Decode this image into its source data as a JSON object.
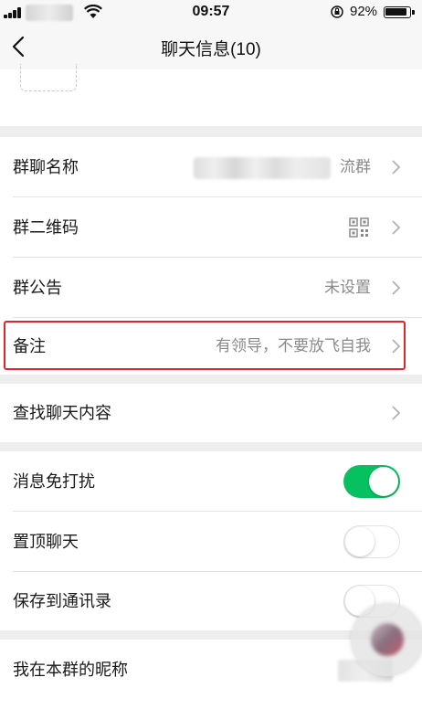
{
  "status_bar": {
    "time": "09:57",
    "battery_percent": "92%"
  },
  "nav": {
    "title": "聊天信息(10)",
    "back_icon": "chevron-left-icon"
  },
  "settings": {
    "group_name": {
      "label": "群聊名称",
      "value": "流群"
    },
    "group_qr": {
      "label": "群二维码",
      "icon": "qr-code-icon"
    },
    "announcement": {
      "label": "群公告",
      "value": "未设置"
    },
    "remark": {
      "label": "备注",
      "value": "有领导，不要放飞自我"
    },
    "search_history": {
      "label": "查找聊天内容"
    },
    "mute": {
      "label": "消息免打扰",
      "on": true
    },
    "pin": {
      "label": "置顶聊天",
      "on": false
    },
    "save_contacts": {
      "label": "保存到通讯录",
      "on": false
    },
    "my_nickname": {
      "label": "我在本群的昵称"
    }
  },
  "colors": {
    "accent_green": "#07c160",
    "highlight_red": "#e0242b",
    "background": "#ededed"
  }
}
